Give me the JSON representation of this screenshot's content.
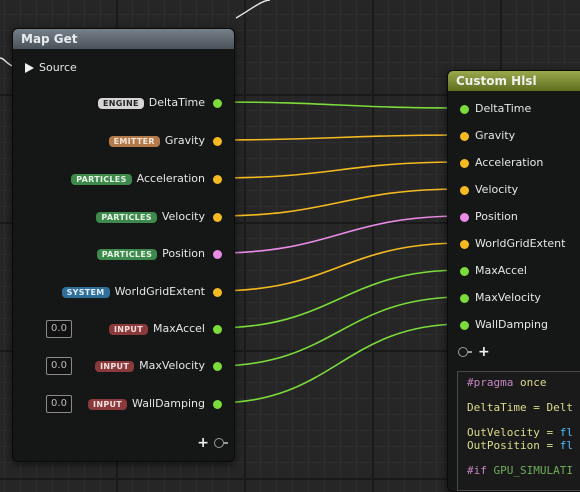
{
  "map_get": {
    "title": "Map Get",
    "source_label": "Source",
    "outputs": [
      {
        "id": "deltatime",
        "badge": "ENGINE",
        "badge_bg": "#d5d5d5",
        "badge_fg": "#222222",
        "label": "DeltaTime",
        "pin_color": "#7bdc3c"
      },
      {
        "id": "gravity",
        "badge": "EMITTER",
        "badge_bg": "#b47a4a",
        "badge_fg": "#f3e6d8",
        "label": "Gravity",
        "pin_color": "#f5ba21"
      },
      {
        "id": "acceleration",
        "badge": "PARTICLES",
        "badge_bg": "#3e8a4c",
        "badge_fg": "#e8f3e8",
        "label": "Acceleration",
        "pin_color": "#f5ba21"
      },
      {
        "id": "velocity",
        "badge": "PARTICLES",
        "badge_bg": "#3e8a4c",
        "badge_fg": "#e8f3e8",
        "label": "Velocity",
        "pin_color": "#f5ba21"
      },
      {
        "id": "position",
        "badge": "PARTICLES",
        "badge_bg": "#3e8a4c",
        "badge_fg": "#e8f3e8",
        "label": "Position",
        "pin_color": "#ea8ce6"
      },
      {
        "id": "worldgridextent",
        "badge": "SYSTEM",
        "badge_bg": "#2f6f9a",
        "badge_fg": "#e2eef7",
        "label": "WorldGridExtent",
        "pin_color": "#f5ba21"
      },
      {
        "id": "maxaccel",
        "badge": "INPUT",
        "badge_bg": "#8a3a3a",
        "badge_fg": "#f3e0e0",
        "label": "MaxAccel",
        "pin_color": "#7bdc3c",
        "default": "0.0"
      },
      {
        "id": "maxvelocity",
        "badge": "INPUT",
        "badge_bg": "#8a3a3a",
        "badge_fg": "#f3e0e0",
        "label": "MaxVelocity",
        "pin_color": "#7bdc3c",
        "default": "0.0"
      },
      {
        "id": "walldamping",
        "badge": "INPUT",
        "badge_bg": "#8a3a3a",
        "badge_fg": "#f3e0e0",
        "label": "WallDamping",
        "pin_color": "#7bdc3c",
        "default": "0.0"
      }
    ]
  },
  "custom_hlsl": {
    "title": "Custom Hlsl",
    "inputs": [
      {
        "label": "DeltaTime",
        "pin_color": "#7bdc3c"
      },
      {
        "label": "Gravity",
        "pin_color": "#f5ba21"
      },
      {
        "label": "Acceleration",
        "pin_color": "#f5ba21"
      },
      {
        "label": "Velocity",
        "pin_color": "#f5ba21"
      },
      {
        "label": "Position",
        "pin_color": "#ea8ce6"
      },
      {
        "label": "WorldGridExtent",
        "pin_color": "#f5ba21"
      },
      {
        "label": "MaxAccel",
        "pin_color": "#7bdc3c"
      },
      {
        "label": "MaxVelocity",
        "pin_color": "#7bdc3c"
      },
      {
        "label": "WallDamping",
        "pin_color": "#7bdc3c"
      }
    ],
    "code": {
      "line1_directive": "#pragma",
      "line1_rest": " once",
      "line2_var": "DeltaTime",
      "line2_rest": " = Delt",
      "line3_var": "OutVelocity",
      "line3_rest": " = ",
      "line3_type": "fl",
      "line4_var": "OutPosition",
      "line4_rest": " = ",
      "line4_type": "fl",
      "line5_directive": "#if",
      "line5_rest": " GPU_SIMULATI"
    }
  },
  "icons": {
    "add": "+",
    "exec_arrow": "play-arrow",
    "empty_pin": "empty-circle-pin"
  },
  "colors": {
    "float_pin": "#7bdc3c",
    "vector_pin": "#f5ba21",
    "position_pin": "#ea8ce6",
    "map_get_header": "#5b636b",
    "hlsl_header": "#7d8b30"
  }
}
